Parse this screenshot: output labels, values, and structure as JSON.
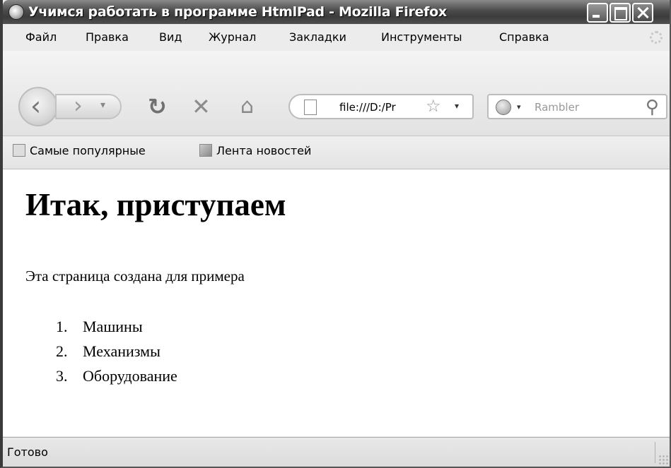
{
  "window": {
    "title": "Учимся работать в программе HtmlPad - Mozilla Firefox"
  },
  "menu": {
    "items": [
      "Файл",
      "Правка",
      "Вид",
      "Журнал",
      "Закладки",
      "Инструменты",
      "Справка"
    ]
  },
  "navigation": {
    "url": "file:///D:/Pr",
    "search_placeholder": "Rambler"
  },
  "bookmarks": {
    "items": [
      "Самые популярные",
      "Лента новостей"
    ]
  },
  "page": {
    "heading": "Итак, приступаем",
    "paragraph": "Эта страница создана для примера",
    "list": [
      {
        "num": "1.",
        "text": "Машины"
      },
      {
        "num": "2.",
        "text": "Механизмы"
      },
      {
        "num": "3.",
        "text": "Оборудование"
      }
    ]
  },
  "status": {
    "text": "Готово"
  }
}
